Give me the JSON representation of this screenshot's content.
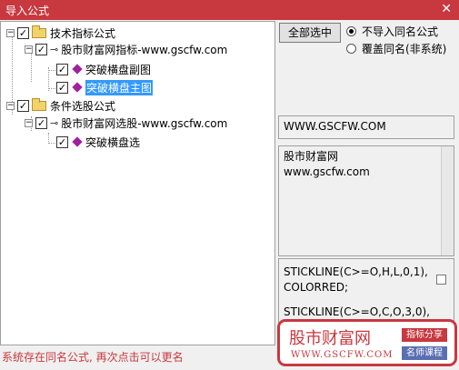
{
  "window": {
    "title": "导入公式",
    "close": "✕"
  },
  "tree": {
    "root1": {
      "label": "技术指标公式",
      "expander": "−",
      "check": "✓"
    },
    "sub1": {
      "label": "股市财富网指标-www.gscfw.com",
      "expander": "−",
      "check": "✓",
      "icon": "⊸"
    },
    "item1": {
      "label": "突破横盘副图",
      "check": "✓"
    },
    "item2": {
      "label": "突破横盘主图",
      "check": "✓"
    },
    "root2": {
      "label": "条件选股公式",
      "expander": "−",
      "check": "✓"
    },
    "sub2": {
      "label": "股市财富网选股-www.gscfw.com",
      "expander": "−",
      "check": "✓",
      "icon": "⊸"
    },
    "item3": {
      "label": "突破横盘选",
      "check": "✓"
    }
  },
  "controls": {
    "select_all": "全部选中",
    "radio1": "不导入同名公式",
    "radio2": "覆盖同名(非系统)"
  },
  "panels": {
    "url": "WWW.GSCFW.COM",
    "desc_line1": "股市财富网",
    "desc_line2": "www.gscfw.com",
    "code_line1": "STICKLINE(C>=O,H,L,0,1),",
    "code_line2": "COLORRED;",
    "code_line3": "STICKLINE(C>=O,C,O,3,0),"
  },
  "status": "系统存在同名公式, 再次点击可以更名",
  "watermark": {
    "name": "股市财富网",
    "site": "WWW.GSCFW.COM",
    "tag1": "指标分享",
    "tag2": "名师课程"
  },
  "colors": {
    "titlebar": "#c8383f",
    "selection": "#3399ff",
    "status": "#c8383f",
    "gem": "#a020a0"
  }
}
